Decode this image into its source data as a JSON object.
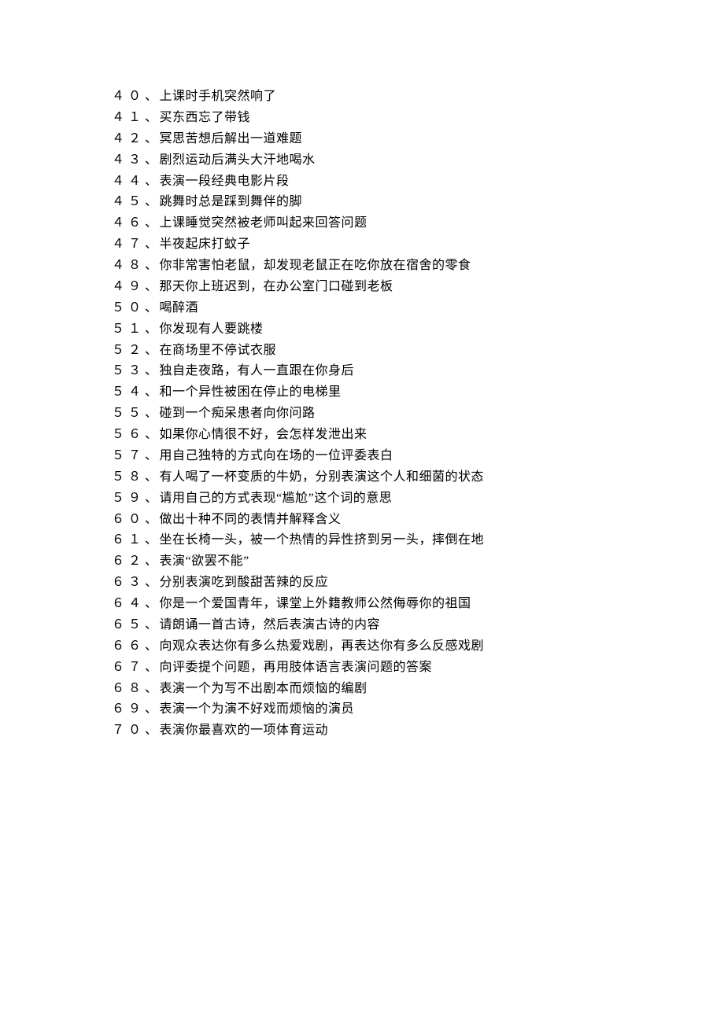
{
  "items": [
    {
      "num": "４０",
      "text": "上课时手机突然响了"
    },
    {
      "num": "４１",
      "text": "买东西忘了带钱"
    },
    {
      "num": "４２",
      "text": "冥思苦想后解出一道难题"
    },
    {
      "num": "４３",
      "text": "剧烈运动后满头大汗地喝水"
    },
    {
      "num": "４４",
      "text": "表演一段经典电影片段"
    },
    {
      "num": "４５",
      "text": "跳舞时总是踩到舞伴的脚"
    },
    {
      "num": "４６",
      "text": "上课睡觉突然被老师叫起来回答问题"
    },
    {
      "num": "４７",
      "text": "半夜起床打蚊子"
    },
    {
      "num": "４８",
      "text": "你非常害怕老鼠，却发现老鼠正在吃你放在宿舍的零食"
    },
    {
      "num": "４９",
      "text": "那天你上班迟到，在办公室门口碰到老板"
    },
    {
      "num": "５０",
      "text": "喝醉酒"
    },
    {
      "num": "５１",
      "text": "你发现有人要跳楼"
    },
    {
      "num": "５２",
      "text": "在商场里不停试衣服"
    },
    {
      "num": "５３",
      "text": "独自走夜路，有人一直跟在你身后"
    },
    {
      "num": "５４",
      "text": "和一个异性被困在停止的电梯里"
    },
    {
      "num": "５５",
      "text": "碰到一个痴呆患者向你问路"
    },
    {
      "num": "５６",
      "text": "如果你心情很不好，会怎样发泄出来"
    },
    {
      "num": "５７",
      "text": "用自己独特的方式向在场的一位评委表白"
    },
    {
      "num": "５８",
      "text": "有人喝了一杯变质的牛奶，分别表演这个人和细菌的状态"
    },
    {
      "num": "５９",
      "text": "请用自己的方式表现“尴尬”这个词的意思"
    },
    {
      "num": "６０",
      "text": "做出十种不同的表情并解释含义"
    },
    {
      "num": "６１",
      "text": "坐在长椅一头，被一个热情的异性挤到另一头，摔倒在地"
    },
    {
      "num": "６２",
      "text": "表演“欲罢不能”"
    },
    {
      "num": "６３",
      "text": "分别表演吃到酸甜苦辣的反应"
    },
    {
      "num": "６４",
      "text": "你是一个爱国青年，课堂上外籍教师公然侮辱你的祖国"
    },
    {
      "num": "６５",
      "text": "请朗诵一首古诗，然后表演古诗的内容"
    },
    {
      "num": "６６",
      "text": "向观众表达你有多么热爱戏剧，再表达你有多么反感戏剧"
    },
    {
      "num": "６７",
      "text": "向评委提个问题，再用肢体语言表演问题的答案"
    },
    {
      "num": "６８",
      "text": "表演一个为写不出剧本而烦恼的编剧"
    },
    {
      "num": "６９",
      "text": "表演一个为演不好戏而烦恼的演员"
    },
    {
      "num": "７０",
      "text": "表演你最喜欢的一项体育运动"
    }
  ],
  "separator": "、"
}
